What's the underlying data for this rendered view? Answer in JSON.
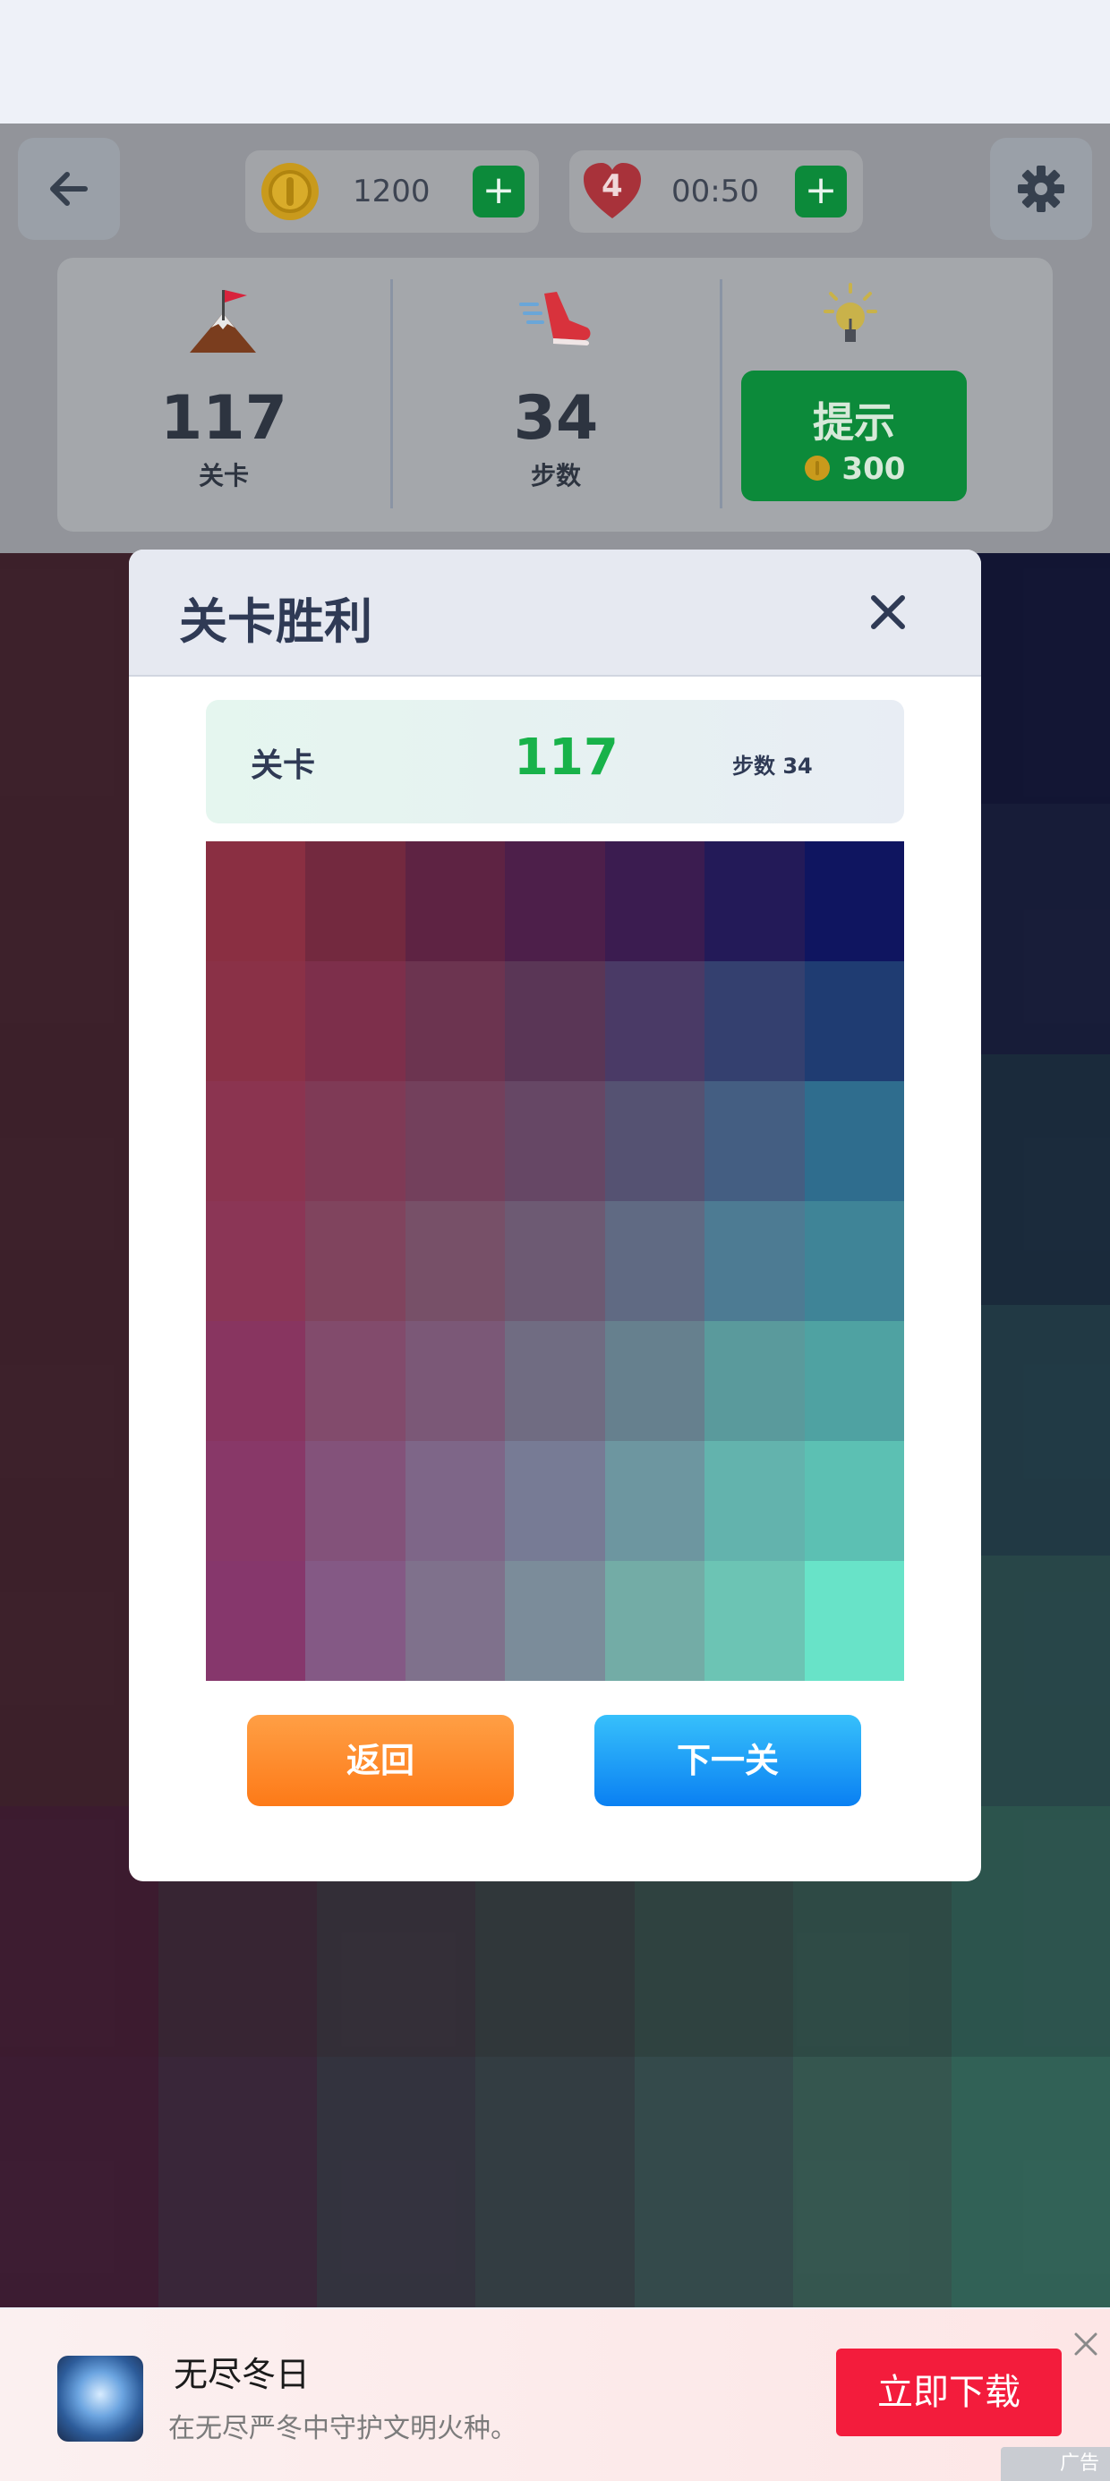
{
  "top_bar": {
    "coins_value": "1200",
    "lives_count": "4",
    "lives_timer": "00:50",
    "plus_label": "+"
  },
  "stats": {
    "level_value": "117",
    "level_label": "关卡",
    "steps_value": "34",
    "steps_label": "步数",
    "hint_label": "提示",
    "hint_cost": "300"
  },
  "modal": {
    "title": "关卡胜利",
    "level_label": "关卡",
    "level_value": "117",
    "steps_text": "步数 34",
    "back_label": "返回",
    "next_label": "下一关"
  },
  "mosaic_colors": [
    [
      "#8a2f42",
      "#73293f",
      "#5e2343",
      "#4d1f4a",
      "#3b1c50",
      "#231a58",
      "#0f1560"
    ],
    [
      "#8a3147",
      "#7d2f4b",
      "#6c3450",
      "#5a3656",
      "#4a3a66",
      "#34406f",
      "#1f3c72"
    ],
    [
      "#8b3450",
      "#7f3a56",
      "#73405c",
      "#664765",
      "#555272",
      "#445e82",
      "#2f6d8e"
    ],
    [
      "#8b3656",
      "#80445e",
      "#775068",
      "#6d5a73",
      "#606a83",
      "#4d7b93",
      "#3f8497"
    ],
    [
      "#883560",
      "#824b6c",
      "#7b5877",
      "#706c82",
      "#66808e",
      "#5a9a9c",
      "#4fa2a2"
    ],
    [
      "#883868",
      "#83527a",
      "#7e6688",
      "#777b95",
      "#6d96a0",
      "#63b3ad",
      "#5cc0b3"
    ],
    [
      "#86376c",
      "#845985",
      "#7f718c",
      "#7b8c9a",
      "#73aca6",
      "#6cc4b4",
      "#68e3c8"
    ]
  ],
  "background_grid_colors": [
    [
      "#5a2a38",
      "#5a2a38",
      "#5a2a38",
      "#5a2a38",
      "#5a2a38",
      "#5a2a38",
      "#121748"
    ],
    [
      "#5a2a38",
      "#5a2a38",
      "#5a2a38",
      "#5a2a38",
      "#5a2a38",
      "#5a2a38",
      "#1b2450"
    ],
    [
      "#5a2a38",
      "#5a2a38",
      "#5a2a38",
      "#5a2a38",
      "#5a2a38",
      "#5a2a38",
      "#203b55"
    ],
    [
      "#5a2a38",
      "#5a2a38",
      "#5a2a38",
      "#5a2a38",
      "#5a2a38",
      "#5a2a38",
      "#2b5564"
    ],
    [
      "#5a2a38",
      "#5a2a38",
      "#5a2a38",
      "#5a2a38",
      "#5a2a38",
      "#5a2a38",
      "#376b6c"
    ],
    [
      "#5a2240",
      "#523348",
      "#4b424e",
      "#465254",
      "#44645e",
      "#437367",
      "#3f8374"
    ],
    [
      "#5a2446",
      "#553551",
      "#4b4a5a",
      "#4b5c61",
      "#4d7270",
      "#4e8777",
      "#489a84"
    ]
  ],
  "ad": {
    "title": "无尽冬日",
    "subtitle": "在无尽严冬中守护文明火种。",
    "cta": "立即下载",
    "tag": "广告"
  },
  "icons": [
    "back-arrow-icon",
    "coin-icon",
    "heart-icon",
    "gear-icon",
    "mountain-flag-icon",
    "shoe-icon",
    "lightbulb-icon",
    "close-icon"
  ],
  "colors": {
    "green_accent": "#18b24a",
    "orange_button": "#fd7a18",
    "blue_button": "#0a80f2",
    "ad_red": "#f31c3c"
  }
}
